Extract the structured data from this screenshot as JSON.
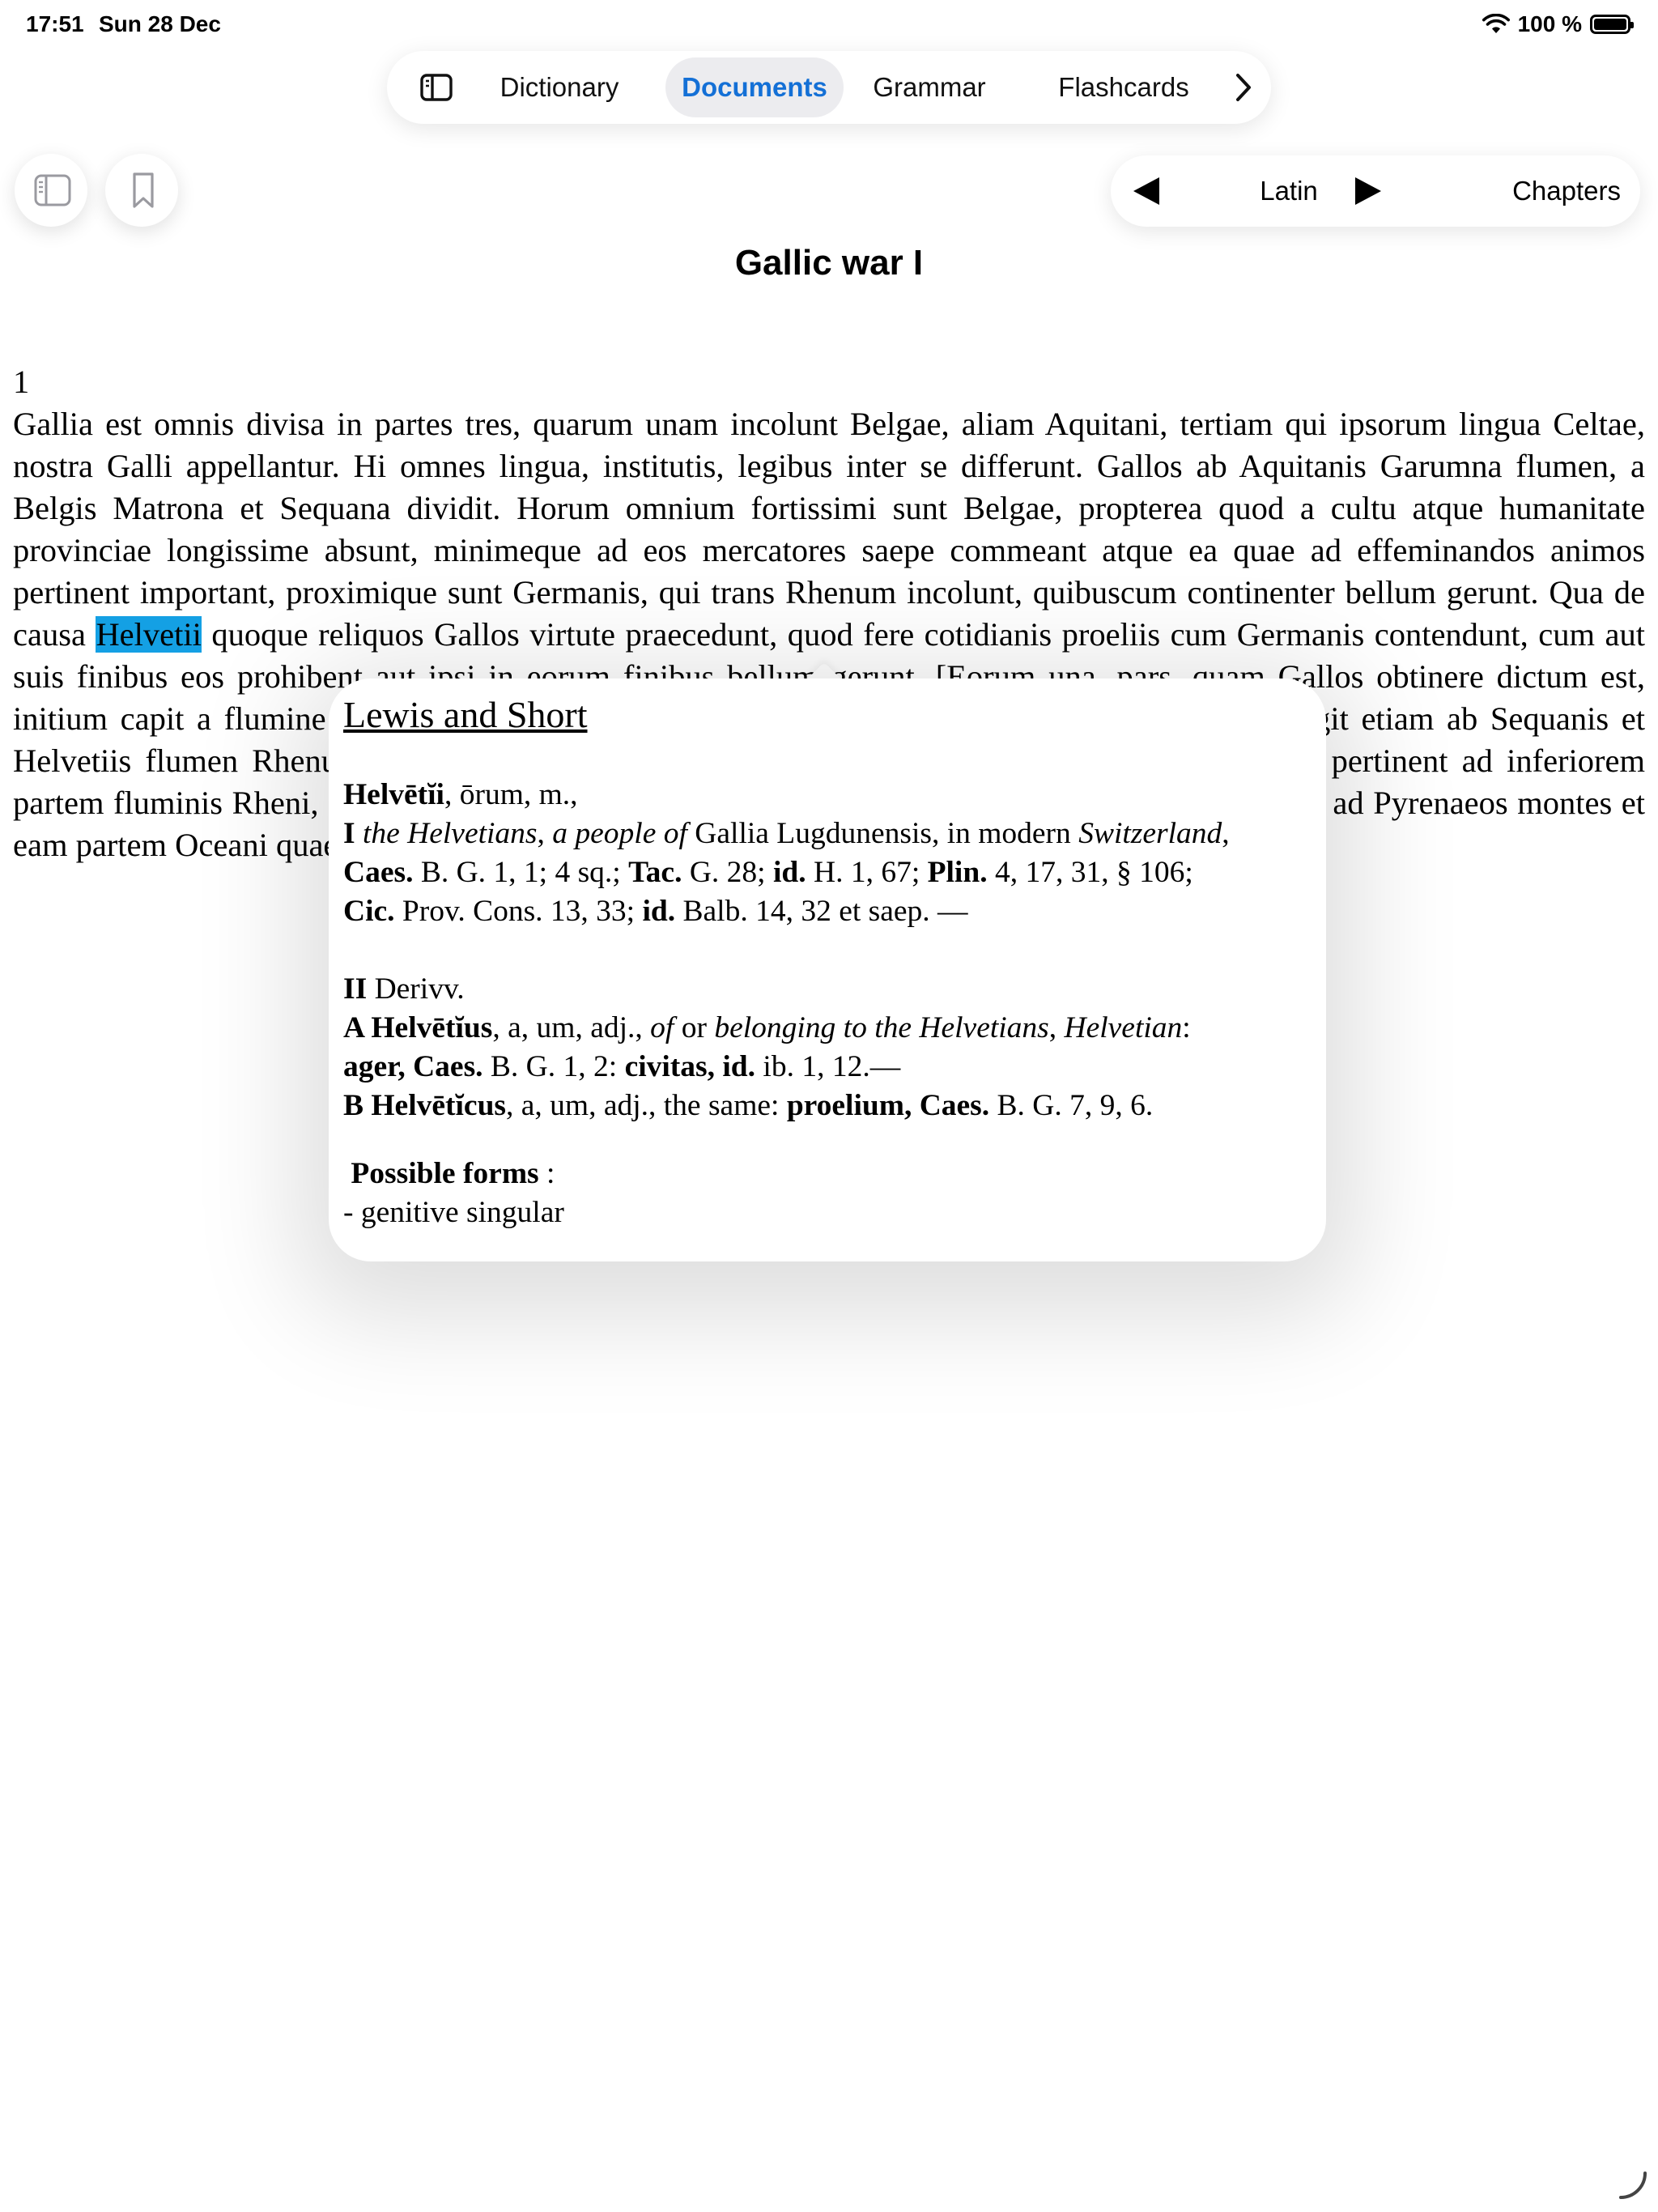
{
  "status_bar": {
    "time": "17:51",
    "date": "Sun 28 Dec",
    "battery": "100 %"
  },
  "tabs": [
    {
      "label": "Dictionary",
      "active": false
    },
    {
      "label": "Documents",
      "active": true
    },
    {
      "label": "Grammar",
      "active": false
    },
    {
      "label": "Flashcards",
      "active": false
    }
  ],
  "nav": {
    "language": "Latin",
    "chapters_label": "Chapters"
  },
  "document": {
    "title": "Gallic war I",
    "section_number": "1",
    "text_before": "Gallia est omnis divisa in partes tres, quarum unam incolunt Belgae, aliam Aquitani, tertiam qui ipsorum lingua Celtae, nostra Galli appellantur. Hi omnes lingua, institutis, legibus inter se differunt. Gallos ab Aquitanis Garumna flumen, a Belgis Matrona et Sequana dividit. Horum omnium fortissimi sunt Belgae, propterea quod a cultu atque humanitate provinciae longissime absunt, minimeque ad eos mercatores saepe commeant atque ea quae ad effeminandos animos pertinent important, proximique sunt Germanis, qui trans Rhenum incolunt, quibuscum continenter bellum gerunt. Qua de causa ",
    "highlighted_word": "Helvetii",
    "text_after": " quoque reliquos Gallos virtute praecedunt, quod fere cotidianis proeliis cum Germanis contendunt, cum aut suis finibus eos prohibent aut ipsi in eorum finibus bellum gerunt. [Eorum una, pars, quam Gallos obtinere dictum est, initium capit a flumine Rhodano, continetur Garumna flumine, Oceano, finibus Belgarum, attingit etiam ab Sequanis et Helvetiis flumen Rhenum, vergit ad septentriones. Belgae ab extremis Galliae finibus oriuntur, pertinent ad inferiorem partem fluminis Rheni, spectant in septentrionem et orientem solem. Aquitania a Garumna flumine ad Pyrenaeos montes et eam partem Oceani quae est ad Hispaniam pertinet; spectat inter occasum solis et septentriones.]"
  },
  "popover": {
    "source": "Lewis and Short",
    "headword": "Helvētĭi",
    "headword_rest": ", ōrum, m.,",
    "sense1": {
      "label": "I",
      "t1": "the Helvetians",
      "t2": ",",
      "t3": "a people of",
      "t4": "Gallia Lugdunensis, in modern",
      "t5": "Switzerland",
      "t6": ",",
      "c1": "Caes.",
      "c1r": "B. G. 1, 1; 4 sq.;",
      "c2": "Tac.",
      "c2r": "G. 28;",
      "c3": "id.",
      "c3r": "H. 1, 67;",
      "c4": "Plin.",
      "c4r": "4, 17, 31, § 106;",
      "c5": "Cic.",
      "c5r": "Prov. Cons. 13, 33;",
      "c6": "id.",
      "c6r": "Balb. 14, 32 et saep. —"
    },
    "sense2": {
      "label": "II",
      "text": "Derivv.",
      "a_label": "A Helvētĭus",
      "a_text": ", a, um, adj.,",
      "a_of": "of",
      "a_or": "or",
      "a_gloss": "belonging to the Helvetians",
      "a_comma": ",",
      "a_gloss2": "Helvetian",
      "a_colon": ":",
      "a_c1": "ager, Caes.",
      "a_c1r": "B. G. 1, 2:",
      "a_c2": "civitas, id.",
      "a_c2r": "ib. 1, 12.—",
      "b_label": "B Helvētĭcus",
      "b_text": ", a, um, adj., the same:",
      "b_c1": "proelium, Caes.",
      "b_c1r": "B. G. 7, 9, 6."
    },
    "forms_label": "Possible forms",
    "forms_colon": " :",
    "forms_items": [
      "- genitive singular"
    ]
  },
  "icons": {
    "sidebar": "sidebar-icon",
    "more": "chevron-right-icon",
    "library": "book-list-icon",
    "bookmark": "bookmark-icon",
    "prev": "triangle-left-icon",
    "next": "triangle-right-icon"
  },
  "colors": {
    "accent": "#1470d6",
    "highlight": "#14a0e4"
  }
}
